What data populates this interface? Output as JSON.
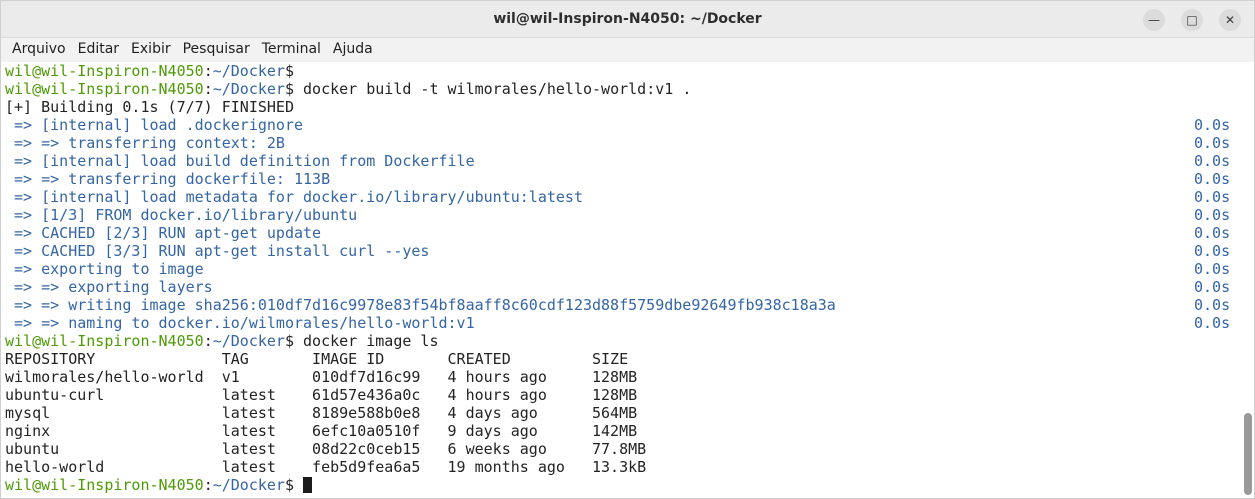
{
  "window": {
    "title": "wil@wil-Inspiron-N4050: ~/Docker"
  },
  "menu": [
    "Arquivo",
    "Editar",
    "Exibir",
    "Pesquisar",
    "Terminal",
    "Ajuda"
  ],
  "prompt": {
    "user": "wil@wil-Inspiron-N4050",
    "sep": ":",
    "path": "~/Docker",
    "symbol": "$"
  },
  "commands": {
    "build": " docker build -t wilmorales/hello-world:v1 .",
    "ls": " docker image ls"
  },
  "build_header": "[+] Building 0.1s (7/7) FINISHED",
  "build_steps": [
    {
      "text": " => [internal] load .dockerignore",
      "time": "0.0s"
    },
    {
      "text": " => => transferring context: 2B",
      "time": "0.0s"
    },
    {
      "text": " => [internal] load build definition from Dockerfile",
      "time": "0.0s"
    },
    {
      "text": " => => transferring dockerfile: 113B",
      "time": "0.0s"
    },
    {
      "text": " => [internal] load metadata for docker.io/library/ubuntu:latest",
      "time": "0.0s"
    },
    {
      "text": " => [1/3] FROM docker.io/library/ubuntu",
      "time": "0.0s"
    },
    {
      "text": " => CACHED [2/3] RUN apt-get update",
      "time": "0.0s"
    },
    {
      "text": " => CACHED [3/3] RUN apt-get install curl --yes",
      "time": "0.0s"
    },
    {
      "text": " => exporting to image",
      "time": "0.0s"
    },
    {
      "text": " => => exporting layers",
      "time": "0.0s"
    },
    {
      "text": " => => writing image sha256:010df7d16c9978e83f54bf8aaff8c60cdf123d88f5759dbe92649fb938c18a3a",
      "time": "0.0s"
    },
    {
      "text": " => => naming to docker.io/wilmorales/hello-world:v1",
      "time": "0.0s"
    }
  ],
  "images_table": [
    "REPOSITORY              TAG       IMAGE ID       CREATED         SIZE",
    "wilmorales/hello-world  v1        010df7d16c99   4 hours ago     128MB",
    "ubuntu-curl             latest    61d57e436a0c   4 hours ago     128MB",
    "mysql                   latest    8189e588b0e8   4 days ago      564MB",
    "nginx                   latest    6efc10a0510f   9 days ago      142MB",
    "ubuntu                  latest    08d22c0ceb15   6 weeks ago     77.8MB",
    "hello-world             latest    feb5d9fea6a5   19 months ago   13.3kB"
  ],
  "icons": {
    "minimize": "minimize-icon",
    "maximize": "maximize-icon",
    "close": "close-icon"
  }
}
